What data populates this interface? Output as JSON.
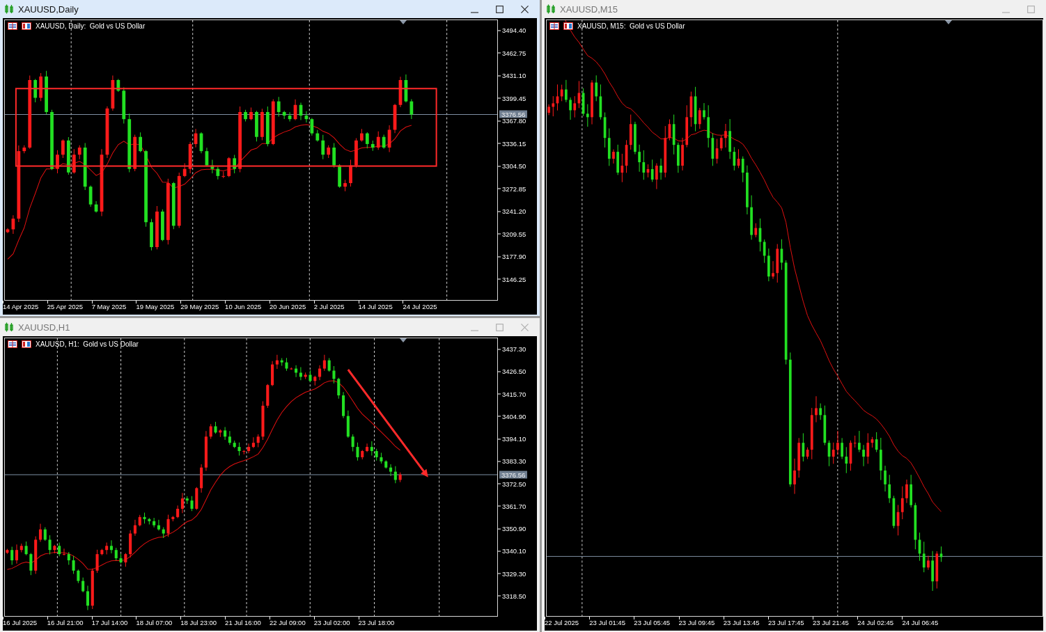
{
  "windows": [
    {
      "title": "XAUUSD,Daily",
      "active": true,
      "buttons": [
        {
          "kind": "minimize"
        },
        {
          "kind": "maximize"
        },
        {
          "kind": "close"
        }
      ],
      "legend": "XAUUSD, Daily:  Gold vs US Dollar",
      "drawing": {
        "kind": "rectangle"
      },
      "price_labels": [
        "3494.40",
        "3462.75",
        "3431.10",
        "3399.45",
        "3367.80",
        "3336.15",
        "3304.50",
        "3272.85",
        "3241.20",
        "3209.55",
        "3177.90",
        "3146.25"
      ],
      "price_tag": "3376.56",
      "time_labels": [
        "14 Apr 2025",
        "25 Apr 2025",
        "7 May 2025",
        "19 May 2025",
        "29 May 2025",
        "10 Jun 2025",
        "20 Jun 2025",
        "2 Jul 2025",
        "14 Jul 2025",
        "24 Jul 2025"
      ]
    },
    {
      "title": "XAUUSD,H1",
      "active": false,
      "buttons": [
        {
          "kind": "minimize"
        },
        {
          "kind": "maximize"
        },
        {
          "kind": "close"
        }
      ],
      "legend": "XAUUSD, H1:  Gold vs US Dollar",
      "drawing": {
        "kind": "arrow"
      },
      "price_labels": [
        "3437.30",
        "3426.50",
        "3415.70",
        "3404.90",
        "3394.10",
        "3383.30",
        "3372.50",
        "3361.70",
        "3350.90",
        "3340.10",
        "3329.30",
        "3318.50"
      ],
      "price_tag": "3376.56",
      "time_labels": [
        "16 Jul 2025",
        "16 Jul 21:00",
        "17 Jul 14:00",
        "18 Jul 07:00",
        "18 Jul 23:00",
        "21 Jul 16:00",
        "22 Jul 09:00",
        "23 Jul 02:00",
        "23 Jul 18:00"
      ]
    },
    {
      "title": "XAUUSD,M15",
      "active": false,
      "buttons": [
        {
          "kind": "minimize"
        },
        {
          "kind": "maximize"
        }
      ],
      "legend": "XAUUSD, M15:  Gold vs US Dollar",
      "time_labels": [
        "22 Jul 2025",
        "23 Jul 01:45",
        "23 Jul 05:45",
        "23 Jul 09:45",
        "23 Jul 13:45",
        "23 Jul 17:45",
        "23 Jul 21:45",
        "24 Jul 02:45",
        "24 Jul 06:45"
      ]
    }
  ]
}
